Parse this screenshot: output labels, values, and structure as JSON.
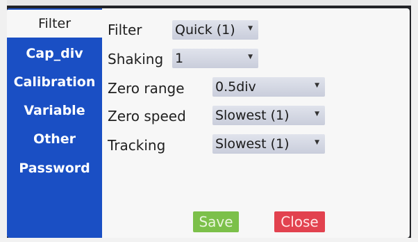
{
  "sidebar": {
    "items": [
      {
        "label": "Filter",
        "active": true
      },
      {
        "label": "Cap_div",
        "active": false
      },
      {
        "label": "Calibration",
        "active": false
      },
      {
        "label": "Variable",
        "active": false
      },
      {
        "label": "Other",
        "active": false
      },
      {
        "label": "Password",
        "active": false
      }
    ]
  },
  "form": {
    "filter": {
      "label": "Filter",
      "value": "Quick (1)"
    },
    "shaking": {
      "label": "Shaking",
      "value": "1"
    },
    "zero_range": {
      "label": "Zero range",
      "value": "0.5div"
    },
    "zero_speed": {
      "label": "Zero speed",
      "value": "Slowest (1)"
    },
    "tracking": {
      "label": "Tracking",
      "value": "Slowest (1)"
    }
  },
  "buttons": {
    "save_label": "Save",
    "close_label": "Close"
  },
  "icons": {
    "dropdown_caret": "chevron-down-icon"
  },
  "colors": {
    "sidebar_bg": "#1a4fc4",
    "save_bg": "#7cc04a",
    "close_bg": "#e2424f"
  }
}
